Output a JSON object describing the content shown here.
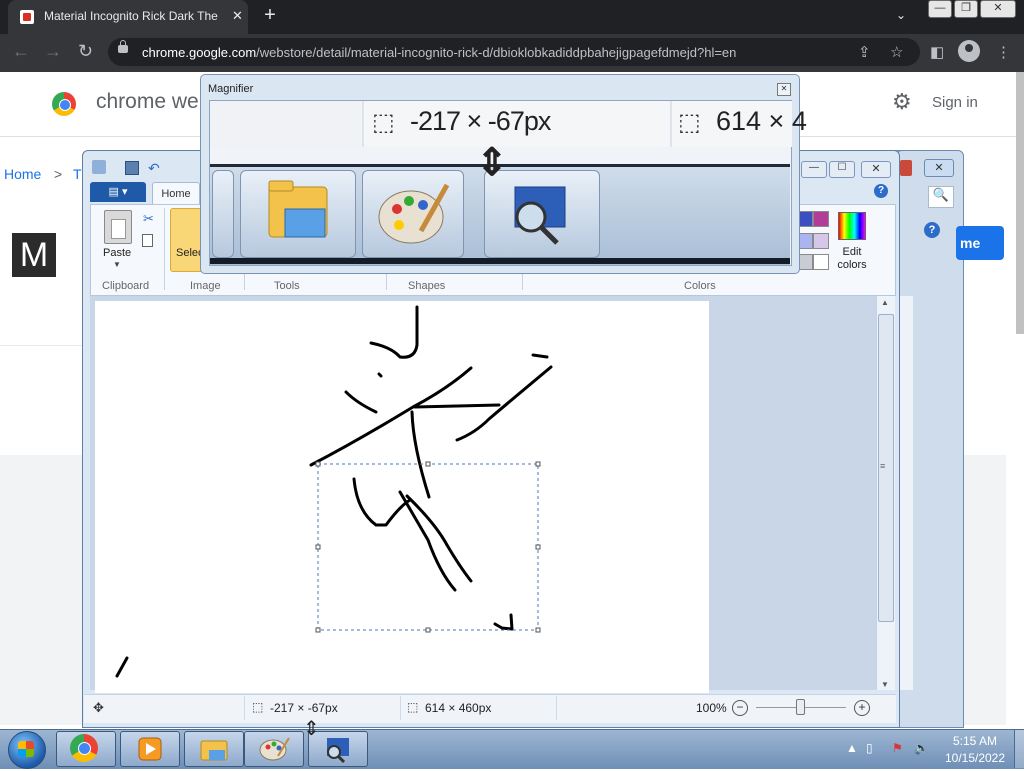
{
  "browser": {
    "tab_title": "Material Incognito Rick Dark The",
    "tab_close": "✕",
    "new_tab": "+",
    "tab_search": "⌄",
    "url_domain": "chrome.google.com",
    "url_path": "/webstore/detail/material-incognito-rick-d/dbioklobkadiddpbahejigpagefdmejd?hl=en",
    "icons": [
      "back-arrow-icon",
      "forward-arrow-icon",
      "reload-icon",
      "lock-icon",
      "share-icon",
      "bookmark-star-icon",
      "sidebar-icon",
      "profile-icon",
      "menu-dots-icon"
    ]
  },
  "webstore": {
    "site_title": "chrome we",
    "sign_in": "Sign in",
    "breadcrumb_home": "Home",
    "breadcrumb_sep": ">",
    "breadcrumb_next": "T",
    "extension_icon_letter": "M",
    "add_button_fragment": "me"
  },
  "back_window": {
    "close": "✕",
    "search_icon": "🔍",
    "help": "?"
  },
  "paint": {
    "title_controls": {
      "minimize": "—",
      "maximize": "☐",
      "close": "✕"
    },
    "menu_button": "▤ ▾",
    "tab_home": "Home",
    "help": "?",
    "ribbon": {
      "paste": "Paste",
      "select": "Selec",
      "edit_colors": "Edit colors",
      "groups": [
        "Clipboard",
        "Image",
        "Tools",
        "Shapes",
        "Colors"
      ]
    },
    "colors": [
      "#3b4fc0",
      "#b23c9a",
      "#aab4ee",
      "#d5c7ea",
      "#c8ccd4",
      "#ffffff"
    ],
    "status": {
      "selection": "-217 × -67px",
      "canvas_size": "614 × 460px",
      "zoom": "100%",
      "zoom_out": "−",
      "zoom_in": "+",
      "zoom_level_fraction": 0.5
    }
  },
  "magnifier": {
    "title": "Magnifier",
    "close": "✕",
    "selection_text": "-217 × -67px",
    "size_text": "614 × 4"
  },
  "taskbar": {
    "clock_time": "5:15 AM",
    "clock_date": "10/15/2022",
    "tray_icons": [
      "show-hidden-icons-arrow",
      "network-icon",
      "action-center-flag-icon",
      "volume-icon"
    ],
    "pinned": [
      "start-button",
      "chrome",
      "media-player",
      "file-explorer",
      "paint",
      "magnifier"
    ]
  }
}
